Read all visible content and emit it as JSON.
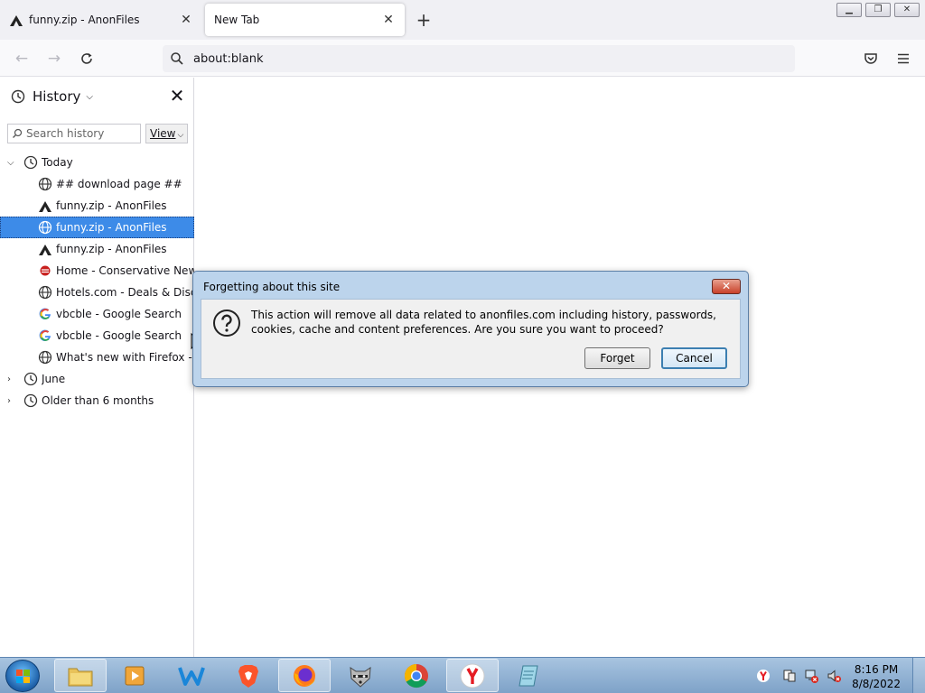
{
  "tabs": [
    {
      "title": "funny.zip - AnonFiles",
      "icon": "anonfiles-icon"
    },
    {
      "title": "New Tab",
      "icon": ""
    }
  ],
  "navbar": {
    "url": "about:blank"
  },
  "sidebar": {
    "title": "History",
    "search_placeholder": "Search history",
    "view_label": "View",
    "groups": [
      {
        "label": "Today",
        "expanded": true,
        "items": [
          {
            "label": "## download page ##",
            "icon": "globe-icon"
          },
          {
            "label": "funny.zip - AnonFiles",
            "icon": "anonfiles-icon"
          },
          {
            "label": "funny.zip - AnonFiles",
            "icon": "globe-icon",
            "selected": true
          },
          {
            "label": "funny.zip - AnonFiles",
            "icon": "anonfiles-icon"
          },
          {
            "label": "Home - Conservative New...",
            "icon": "news-icon"
          },
          {
            "label": "Hotels.com - Deals & Disc...",
            "icon": "globe-icon"
          },
          {
            "label": "vbcble - Google Search",
            "icon": "google-icon"
          },
          {
            "label": "vbcble - Google Search",
            "icon": "google-icon"
          },
          {
            "label": "What's new with Firefox - ...",
            "icon": "globe-icon"
          }
        ]
      },
      {
        "label": "June",
        "expanded": false
      },
      {
        "label": "Older than 6 months",
        "expanded": false
      }
    ]
  },
  "dialog": {
    "title": "Forgetting about this site",
    "message": "This action will remove all data related to anonfiles.com including history, passwords, cookies, cache and content preferences. Are you sure you want to proceed?",
    "forget_label": "Forget",
    "cancel_label": "Cancel"
  },
  "taskbar": {
    "time": "8:16 PM",
    "date": "8/8/2022"
  }
}
